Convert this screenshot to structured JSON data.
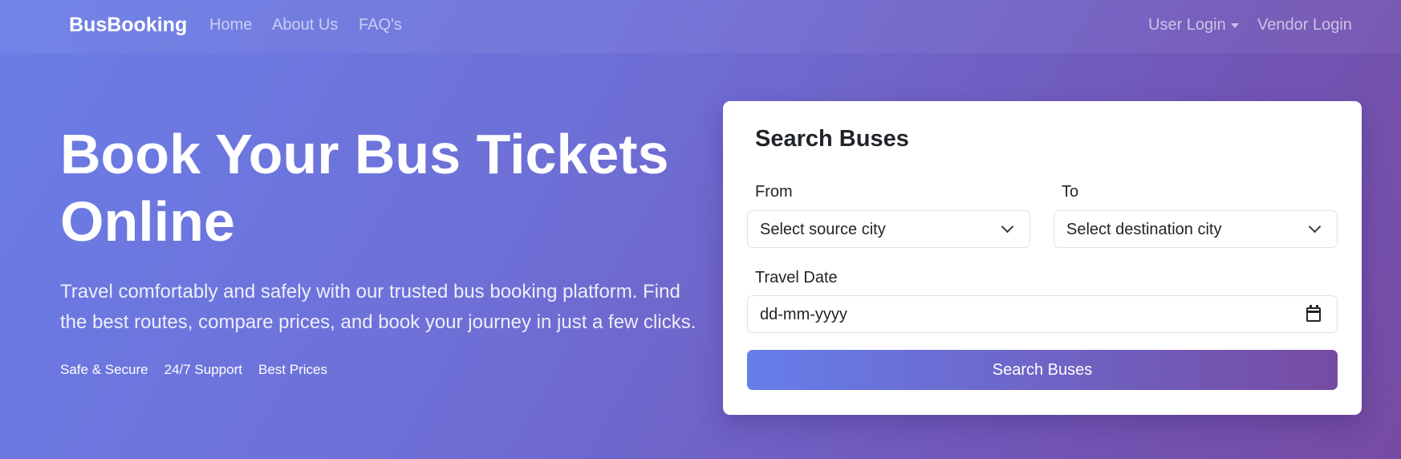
{
  "navbar": {
    "brand": "BusBooking",
    "links": [
      "Home",
      "About Us",
      "FAQ's"
    ],
    "user_login": "User Login",
    "vendor_login": "Vendor Login"
  },
  "hero": {
    "title": "Book Your Bus Tickets Online",
    "description": "Travel comfortably and safely with our trusted bus booking platform. Find the best routes, compare prices, and book your journey in just a few clicks.",
    "features": [
      "Safe & Secure",
      "24/7 Support",
      "Best Prices"
    ]
  },
  "search_card": {
    "title": "Search Buses",
    "from_label": "From",
    "from_placeholder": "Select source city",
    "to_label": "To",
    "to_placeholder": "Select destination city",
    "date_label": "Travel Date",
    "date_placeholder": "dd-mm-yyyy",
    "button": "Search Buses"
  },
  "colors": {
    "gradient_start": "#667eea",
    "gradient_end": "#764ba2"
  }
}
